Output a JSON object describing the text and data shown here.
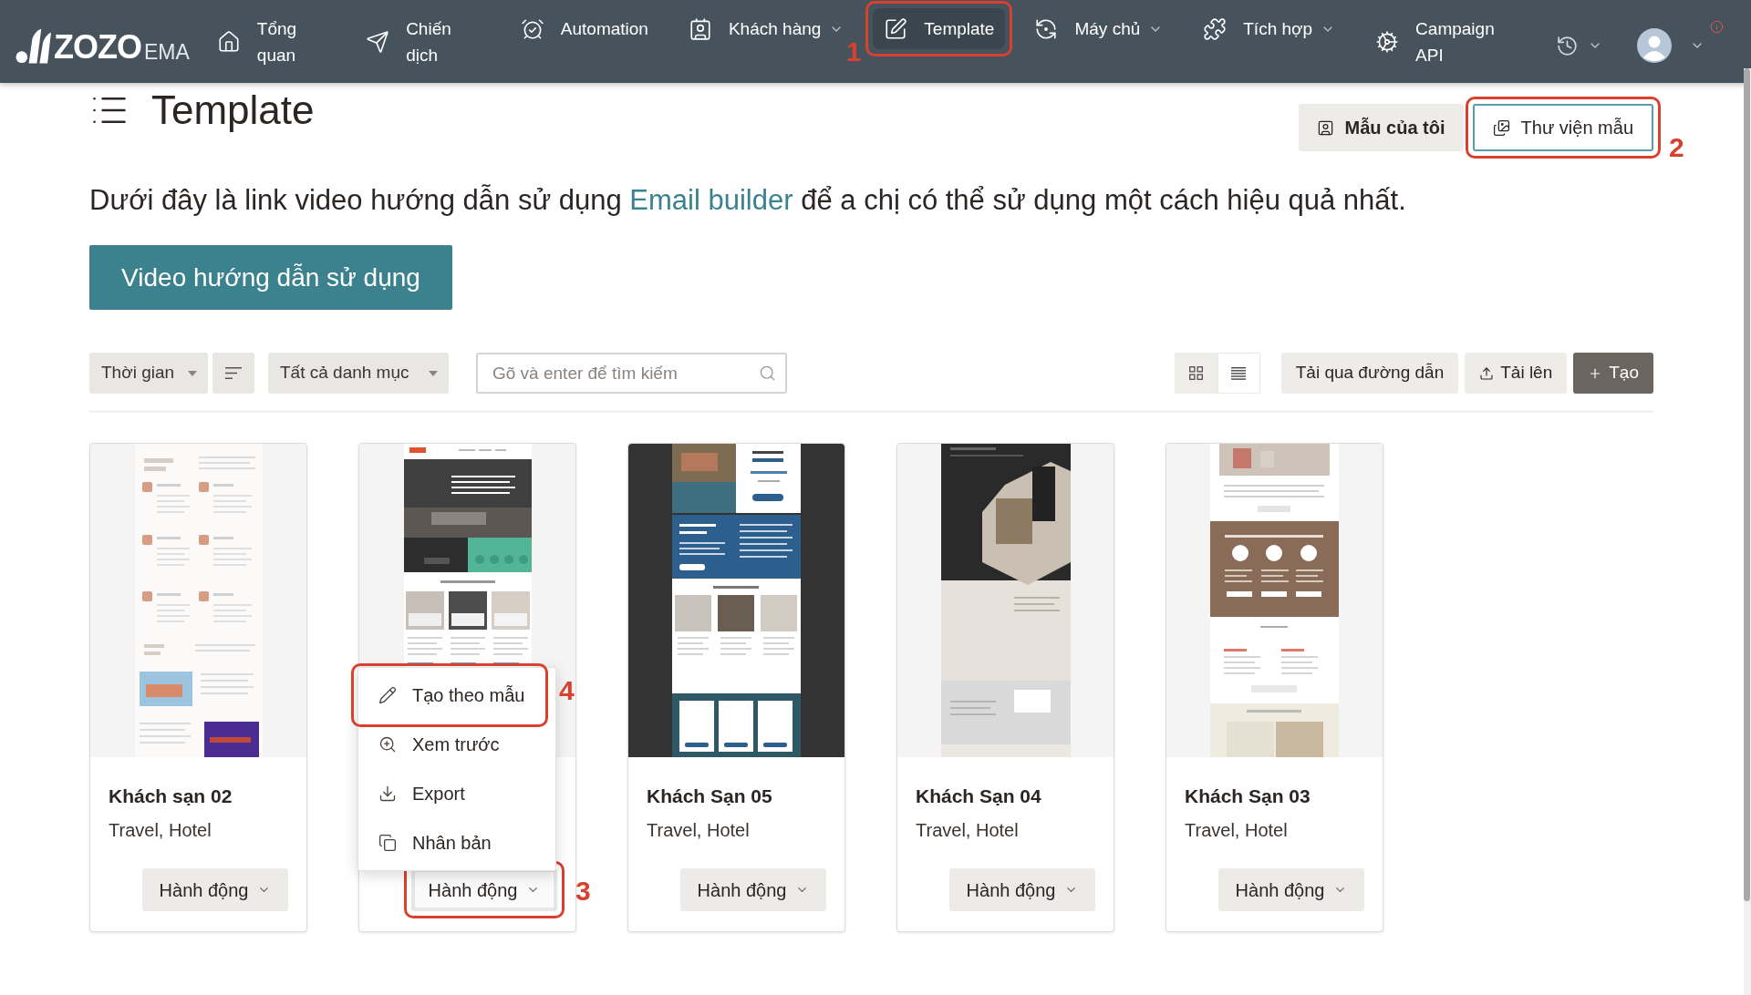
{
  "nav": {
    "brand": {
      "name": "ZOZO",
      "suffix": "EMA"
    },
    "items": [
      {
        "label": "Tổng quan",
        "wrapped": true,
        "dropdown": false,
        "selected": false
      },
      {
        "label": "Chiến dịch",
        "wrapped": true,
        "dropdown": false,
        "selected": false
      },
      {
        "label": "Automation",
        "wrapped": false,
        "dropdown": false,
        "selected": false
      },
      {
        "label": "Khách hàng",
        "wrapped": false,
        "dropdown": true,
        "selected": false
      },
      {
        "label": "Template",
        "wrapped": false,
        "dropdown": false,
        "selected": true,
        "callout": "1"
      },
      {
        "label": "Máy chủ",
        "wrapped": false,
        "dropdown": true,
        "selected": false
      },
      {
        "label": "Tích hợp",
        "wrapped": false,
        "dropdown": true,
        "selected": false
      },
      {
        "label": "Campaign API",
        "wrapped": true,
        "dropdown": false,
        "selected": false
      }
    ]
  },
  "page": {
    "title": "Template",
    "tabs": [
      {
        "label": "Mẫu của tôi",
        "selected": false
      },
      {
        "label": "Thư viện mẫu",
        "selected": true,
        "callout": "2"
      }
    ],
    "intro": {
      "before": "Dưới đây là link video hướng dẫn sử dụng",
      "link": "Email builder",
      "after": "để a chị có thể sử dụng một cách hiệu quả nhất."
    },
    "video_button": "Video hướng dẫn sử dụng"
  },
  "toolbar": {
    "time_filter": "Thời gian",
    "category_filter": "Tất cả danh mục",
    "search": {
      "placeholder": "Gõ và enter để tìm kiếm"
    },
    "views": [
      {
        "selected": true
      },
      {
        "selected": false
      }
    ],
    "actions": [
      {
        "label": "Tải qua đường dẫn",
        "kind": "plain"
      },
      {
        "label": "Tải lên",
        "kind": "upload"
      },
      {
        "label": "Tạo",
        "kind": "create"
      }
    ]
  },
  "cards": [
    {
      "kind": "light",
      "title": "Khách sạn 02",
      "category": "Travel, Hotel",
      "action": {
        "label": "Hành động",
        "expanded": false
      }
    },
    {
      "kind": "room",
      "action": {
        "label": "Hành động",
        "expanded": true,
        "callout": "3"
      },
      "menu": [
        {
          "label": "Tạo theo mẫu",
          "callout": "4"
        },
        {
          "label": "Xem trước"
        },
        {
          "label": "Export"
        },
        {
          "label": "Nhân bản"
        }
      ]
    },
    {
      "kind": "coast",
      "title": "Khách Sạn 05",
      "category": "Travel, Hotel",
      "action": {
        "label": "Hành động",
        "expanded": false
      }
    },
    {
      "kind": "hexagon",
      "title": "Khách Sạn 04",
      "category": "Travel, Hotel",
      "action": {
        "label": "Hành động",
        "expanded": false
      }
    },
    {
      "kind": "brown",
      "title": "Khách Sạn 03",
      "category": "Travel, Hotel",
      "action": {
        "label": "Hành động",
        "expanded": false
      }
    }
  ]
}
